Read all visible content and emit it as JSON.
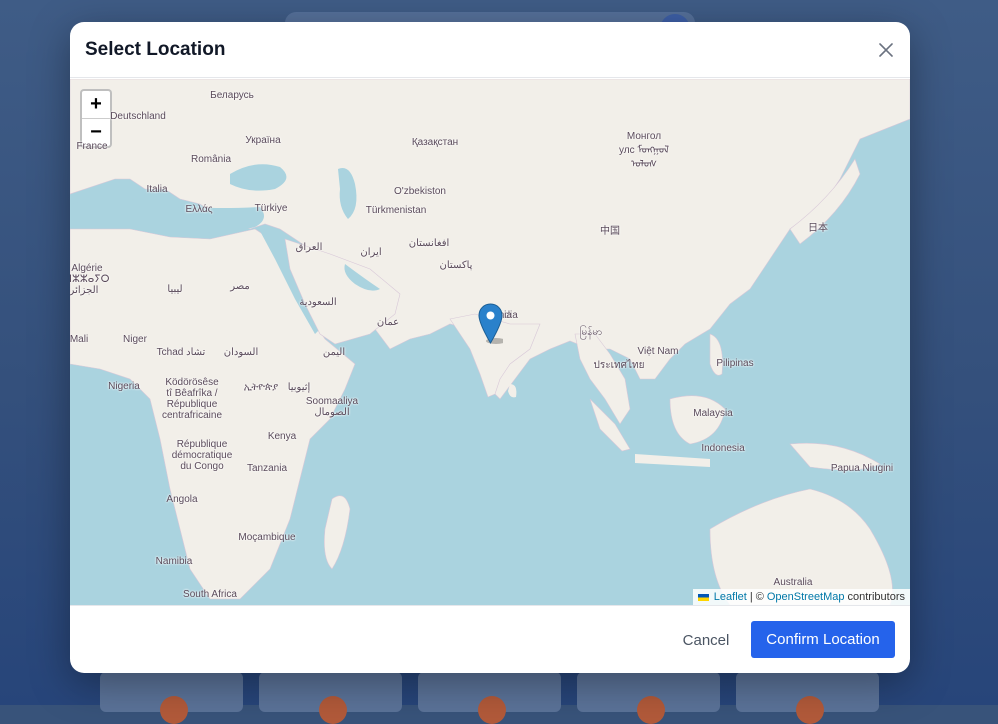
{
  "dialog": {
    "title": "Select Location",
    "close_icon": "close-icon"
  },
  "map": {
    "zoom_in_label": "+",
    "zoom_out_label": "−",
    "marker_icon": "map-pin-icon",
    "marker_color": "#2a81cb",
    "labels": [
      "Беларусь",
      "Deutschland",
      "France",
      "Україна",
      "România",
      "Italia",
      "Ελλάς",
      "Türkiye",
      "Қазақстан",
      "O'zbekiston",
      "Türkmenistan",
      "Монгол",
      "улс ᠮᠣᠩᠭᠣᠯ",
      "ᠤᠯᠤᠰ",
      "中国",
      "日本",
      "العراق",
      "ایران",
      "افغانستان",
      "پاکستان",
      "India",
      "السعودية",
      "عمان",
      "اليمن",
      "Algérie",
      "ⵍⵣⵣⴰⵢⵔ",
      "الجزائر",
      "ليبيا",
      "مصر",
      "Mali",
      "Niger",
      "Tchad تشاد",
      "السودان",
      "Nigeria",
      "Ködörösêse",
      "tî Bêafrîka /",
      "République",
      "centrafricaine",
      "ኢትዮጵያ",
      "إثيوبيا",
      "Soomaaliya",
      "الصومال",
      "Kenya",
      "République",
      "démocratique",
      "du Congo",
      "Tanzania",
      "Angola",
      "Moçambique",
      "Namibia",
      "South Africa",
      "မြန်မာ",
      "Việt Nam",
      "ประเทศไทย",
      "Pilipinas",
      "Malaysia",
      "Indonesia",
      "Papua Niugini",
      "Australia",
      "ia"
    ],
    "attribution": {
      "leaflet": "Leaflet",
      "separator": "| ©",
      "osm": "OpenStreetMap",
      "suffix": "contributors"
    }
  },
  "footer": {
    "cancel_label": "Cancel",
    "confirm_label": "Confirm Location"
  },
  "colors": {
    "primary": "#2563eb",
    "water": "#aad3df",
    "land": "#f2efe9"
  }
}
